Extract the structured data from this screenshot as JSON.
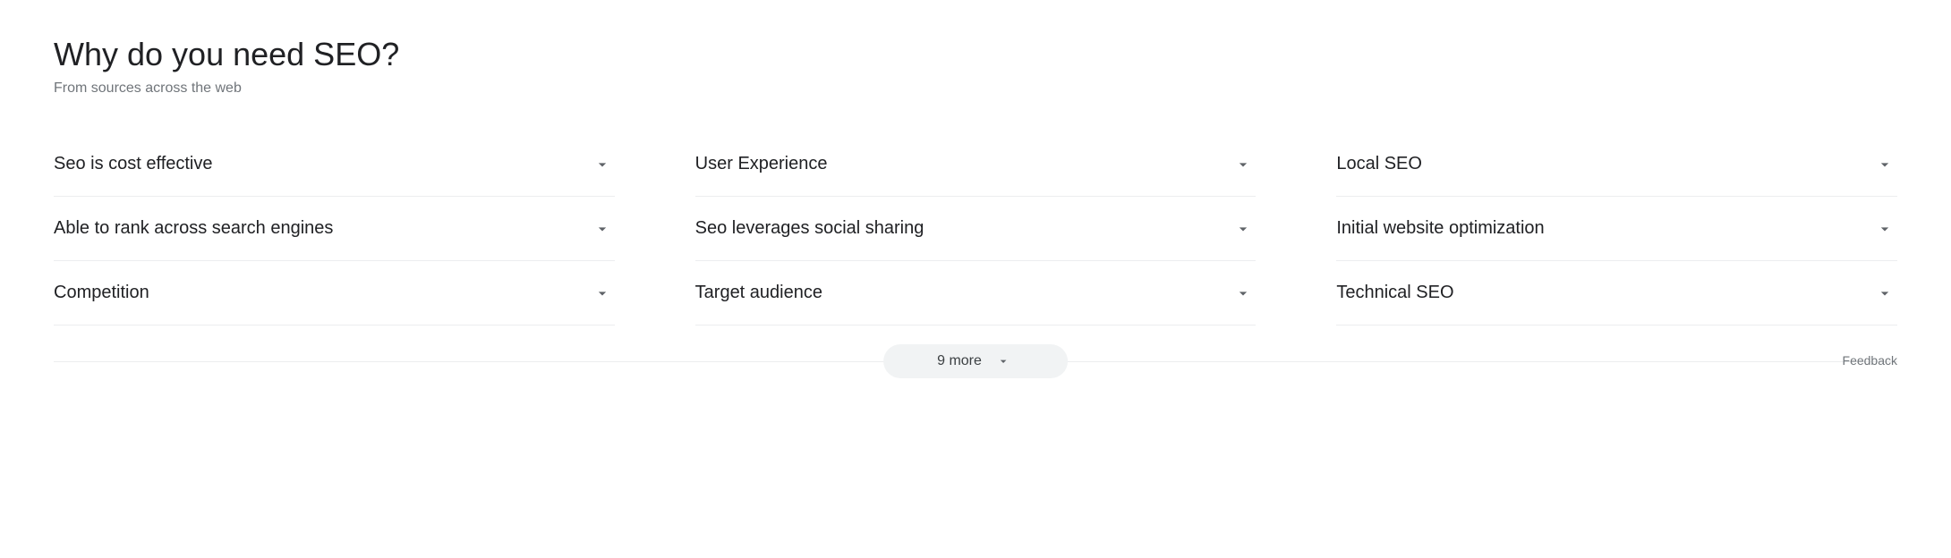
{
  "heading": "Why do you need SEO?",
  "subheading": "From sources across the web",
  "items": [
    {
      "label": "Seo is cost effective"
    },
    {
      "label": "User Experience"
    },
    {
      "label": "Local SEO"
    },
    {
      "label": "Able to rank across search engines"
    },
    {
      "label": "Seo leverages social sharing"
    },
    {
      "label": "Initial website optimization"
    },
    {
      "label": "Competition"
    },
    {
      "label": "Target audience"
    },
    {
      "label": "Technical SEO"
    }
  ],
  "more_label": "9 more",
  "feedback_label": "Feedback"
}
